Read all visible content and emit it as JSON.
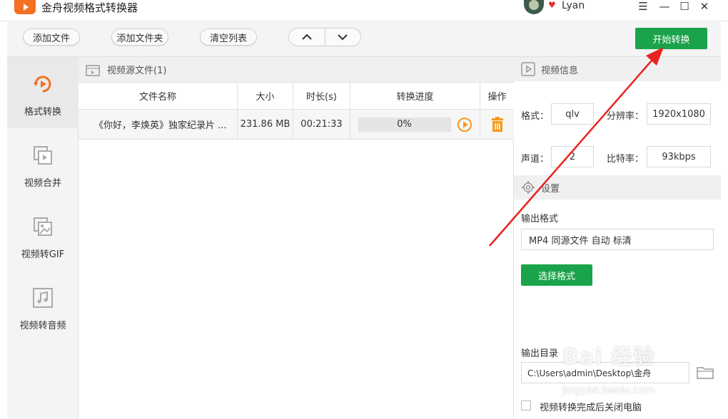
{
  "app": {
    "title": "金舟视频格式转换器",
    "username": "Lyan",
    "window_controls": [
      "menu-icon",
      "minimize-icon",
      "maximize-icon",
      "close-icon"
    ]
  },
  "toolbar": {
    "add_file": "添加文件",
    "add_folder": "添加文件夹",
    "clear_list": "清空列表",
    "move_up": "∧",
    "move_down": "∨",
    "start": "开始转换",
    "accent_color": "#1aa34a"
  },
  "sidebar": {
    "items": [
      {
        "label": "格式转换",
        "icon": "convert-play-icon",
        "active": true
      },
      {
        "label": "视频合并",
        "icon": "video-merge-icon",
        "active": false
      },
      {
        "label": "视频转GIF",
        "icon": "gif-image-icon",
        "active": false
      },
      {
        "label": "视频转音频",
        "icon": "music-note-icon",
        "active": false
      }
    ]
  },
  "file_list": {
    "header": "视频源文件(1)",
    "columns": [
      "文件名称",
      "大小",
      "时长(s)",
      "转换进度",
      "操作"
    ],
    "rows": [
      {
        "name": "《你好，李焕英》独家纪录片 ...",
        "size": "231.86 MB",
        "duration": "00:21:33",
        "progress_text": "0%",
        "progress": 0
      }
    ]
  },
  "video_info": {
    "header": "视频信息",
    "format_label": "格式：",
    "format_value": "qlv",
    "resolution_label": "分辨率：",
    "resolution_value": "1920x1080",
    "channels_label": "声道：",
    "channels_value": "2",
    "bitrate_label": "比特率：",
    "bitrate_value": "93kbps"
  },
  "settings": {
    "header": "设置",
    "output_format_label": "输出格式",
    "output_format_value": "MP4 同源文件 自动 标清",
    "choose_format": "选择格式",
    "output_dir_label": "输出目录",
    "output_dir_value": "C:\\Users\\admin\\Desktop\\金舟",
    "shutdown_label": "视频转换完成后关闭电脑"
  },
  "watermark": {
    "text": "Bai 经验",
    "sub": "jingyan.baidu.com"
  }
}
